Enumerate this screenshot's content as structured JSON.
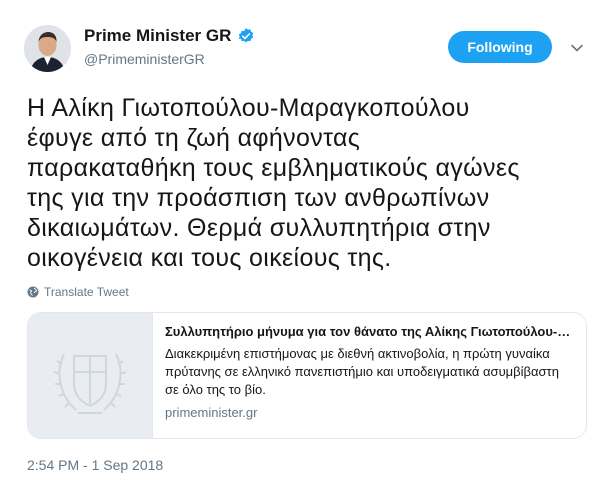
{
  "author": {
    "display_name": "Prime Minister GR",
    "handle": "@PrimeministerGR",
    "verified_icon": "verified-badge-icon"
  },
  "follow_button": {
    "label": "Following",
    "color": "#1da1f2"
  },
  "tweet": {
    "text": "Η Αλίκη Γιωτοπούλου-Μαραγκοπούλου\nέφυγε από τη ζωή αφήνοντας\nπαρακαταθήκη τους εμβληματικούς αγώνες\nτης για την προάσπιση των ανθρωπίνων\nδικαιωμάτων. Θερμά συλλυπητήρια στην\nοικογένεια και τους οικείους της.",
    "translate_label": "Translate Tweet",
    "timestamp": "2:54 PM - 1 Sep 2018"
  },
  "card": {
    "title": "Συλλυπητήριο μήνυμα για τον θάνατο της Αλίκης Γιωτοπούλου-Μαραγκοπούλου",
    "description": "Διακεκριμένη επιστήμονας με διεθνή ακτινοβολία, η πρώτη γυναίκα πρύτανης σε ελληνικό πανεπιστήμιο και υποδειγματικά ασυμβίβαστη σε όλο της το βίο.",
    "domain": "primeminister.gr",
    "image_icon": "greek-coat-of-arms-icon"
  }
}
